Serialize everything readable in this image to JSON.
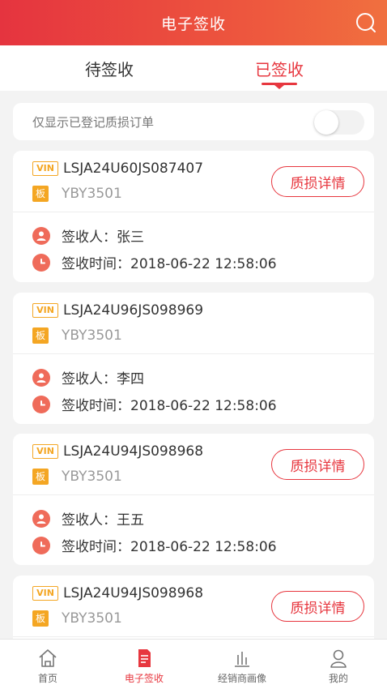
{
  "header": {
    "title": "电子签收"
  },
  "tabs": [
    {
      "label": "待签收",
      "active": false
    },
    {
      "label": "已签收",
      "active": true
    }
  ],
  "filter": {
    "label": "仅显示已登记质损订单",
    "toggle_on": false
  },
  "badges": {
    "vin": "VIN",
    "plate": "板"
  },
  "cards": [
    {
      "vin": "LSJA24U60JS087407",
      "plate": "YBY3501",
      "signer": "签收人：张三",
      "time": "签收时间：2018-06-22 12:58:06",
      "detail_label": "质损详情",
      "has_detail": true
    },
    {
      "vin": "LSJA24U96JS098969",
      "plate": "YBY3501",
      "signer": "签收人：李四",
      "time": "签收时间：2018-06-22 12:58:06",
      "has_detail": false
    },
    {
      "vin": "LSJA24U94JS098968",
      "plate": "YBY3501",
      "signer": "签收人：王五",
      "time": "签收时间：2018-06-22 12:58:06",
      "detail_label": "质损详情",
      "has_detail": true
    },
    {
      "vin": "LSJA24U94JS098968",
      "plate": "YBY3501",
      "detail_label": "质损详情",
      "has_detail": true
    }
  ],
  "tabbar": [
    {
      "label": "首页",
      "icon": "home-icon",
      "active": false
    },
    {
      "label": "电子签收",
      "icon": "document-icon",
      "active": true
    },
    {
      "label": "经销商画像",
      "icon": "bar-chart-icon",
      "active": false
    },
    {
      "label": "我的",
      "icon": "user-icon",
      "active": false
    }
  ],
  "colors": {
    "accent": "#e7373f",
    "badge": "#f4a623",
    "info_icon": "#ef6b5a"
  }
}
